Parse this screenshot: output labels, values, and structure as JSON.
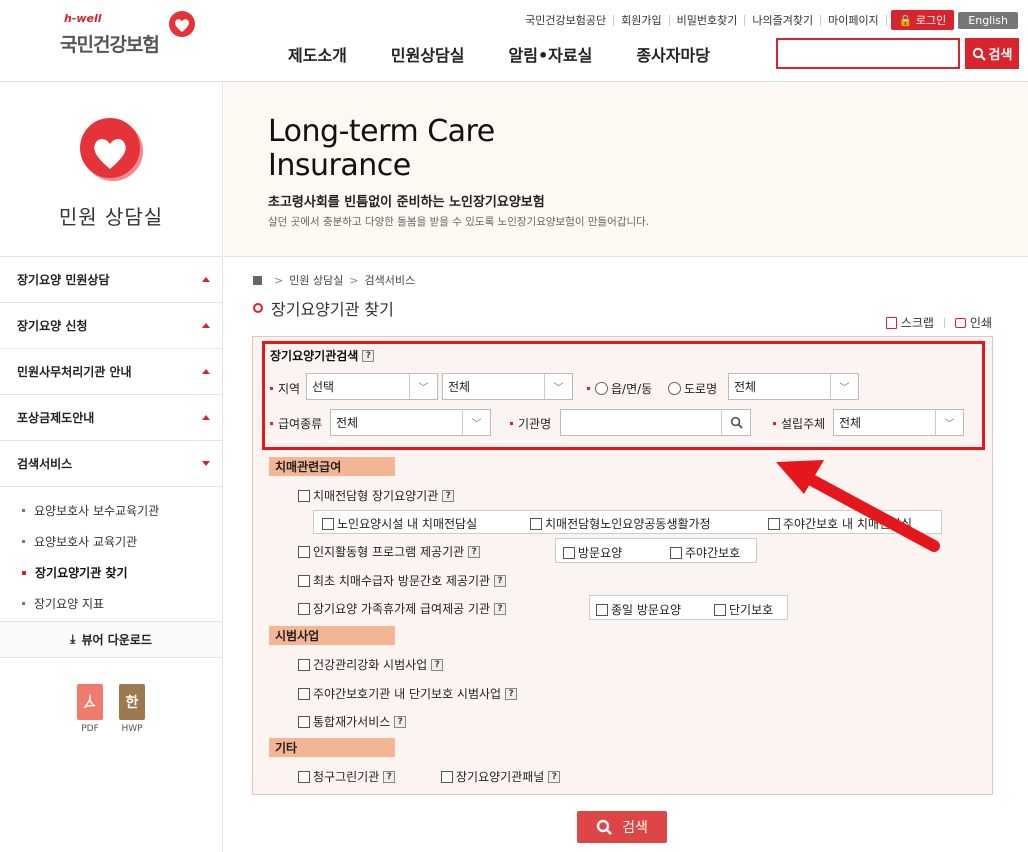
{
  "header": {
    "logo_small": "h-well",
    "logo_main": "국민건강보험",
    "util_links": [
      "국민건강보험공단",
      "회원가입",
      "비밀번호찾기",
      "나의즐겨찾기",
      "마이페이지"
    ],
    "login_label": "로그인",
    "english_label": "English",
    "gnb": [
      "제도소개",
      "민원상담실",
      "알림•자료실",
      "종사자마당"
    ],
    "search_value": "",
    "search_button": "검색"
  },
  "sidebar": {
    "title": "민원 상담실",
    "items": [
      "장기요양 민원상담",
      "장기요양 신청",
      "민원사무처리기관 안내",
      "포상금제도안내",
      "검색서비스"
    ],
    "subitems": [
      "요양보호사 보수교육기관",
      "요양보호사 교육기관",
      "장기요양기관 찾기",
      "장기요양 지표"
    ],
    "active_subitem": "장기요양기관 찾기",
    "viewer_label": "뷰어 다운로드",
    "files": [
      {
        "label": "PDF",
        "glyph": "⤷",
        "color": "#f07b6c"
      },
      {
        "label": "HWP",
        "glyph": "한",
        "color": "#9c7a4f"
      }
    ]
  },
  "banner": {
    "title_line1": "Long-term Care",
    "title_line2": "Insurance",
    "subtitle": "초고령사회를 빈틈없이 준비하는 노인장기요양보험",
    "description": "살던 곳에서 충분하고 다양한 돌봄을 받을 수 있도록 노인장기요양보험이 만들어갑니다."
  },
  "breadcrumb": [
    "민원 상담실",
    "검색서비스"
  ],
  "page_title": "장기요양기관 찾기",
  "tools": {
    "scrap": "스크랩",
    "print": "인쇄"
  },
  "search_form": {
    "title": "장기요양기관검색",
    "help": "?",
    "region_label": "지역",
    "region_select1": "선택",
    "region_select2": "전체",
    "radio_eup": "읍/면/동",
    "radio_road": "도로명",
    "region_select3": "전체",
    "benefit_label": "급여종류",
    "benefit_select": "전체",
    "org_name_label": "기관명",
    "org_name_value": "",
    "founder_label": "설립주체",
    "founder_select": "전체"
  },
  "categories": {
    "dementia": {
      "title": "치매관련급여",
      "main1": "치매전담형 장기요양기관",
      "sub1": [
        "노인요양시설 내 치매전담실",
        "치매전담형노인요양공동생활가정",
        "주야간보호 내 치매전담실"
      ],
      "main2": "인지활동형 프로그램 제공기관",
      "sub2": [
        "방문요양",
        "주야간보호"
      ],
      "main3": "최초 치매수급자 방문간호 제공기관",
      "main4": "장기요양 가족휴가제 급여제공 기관",
      "sub4": [
        "종일 방문요양",
        "단기보호"
      ]
    },
    "pilot": {
      "title": "시범사업",
      "items": [
        "건강관리강화 시범사업",
        "주야간보호기관 내 단기보호 시범사업",
        "통합재가서비스"
      ]
    },
    "etc": {
      "title": "기타",
      "items": [
        "청구그린기관",
        "장기요양기관패널"
      ]
    }
  },
  "search_button": "검색",
  "colors": {
    "accent": "#d9232d",
    "panel_bg": "#fcf4f1",
    "category_bg": "#f4b594",
    "highlight_border": "#e5171c",
    "arrow": "#e5171c"
  }
}
